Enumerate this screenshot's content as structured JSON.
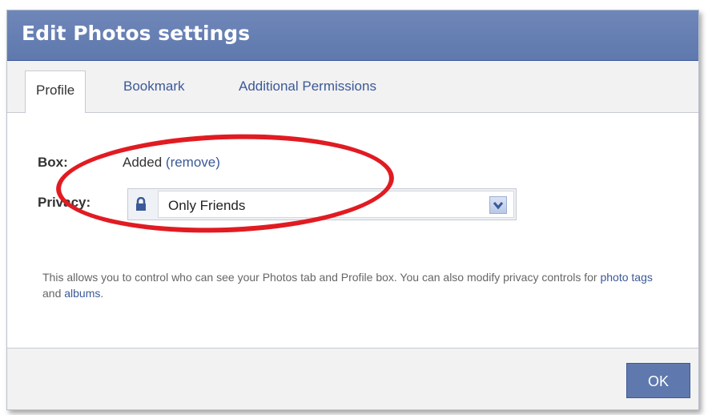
{
  "dialog": {
    "title": "Edit Photos settings"
  },
  "tabs": [
    {
      "label": "Profile",
      "active": true
    },
    {
      "label": "Bookmark",
      "active": false
    },
    {
      "label": "Additional Permissions",
      "active": false
    }
  ],
  "box": {
    "label": "Box:",
    "status": "Added",
    "remove_link": "(remove)"
  },
  "privacy": {
    "label": "Privacy:",
    "selected": "Only Friends",
    "icon": "lock-icon"
  },
  "help": {
    "text_1": "This allows you to control who can see your Photos tab and Profile box. You can also modify privacy controls for ",
    "link_photo_tags": "photo tags",
    "text_and": " and ",
    "link_albums": "albums",
    "text_end": "."
  },
  "footer": {
    "ok_label": "OK"
  },
  "colors": {
    "header": "#6d84b4",
    "link": "#3b5998",
    "highlight": "#e11b22"
  }
}
